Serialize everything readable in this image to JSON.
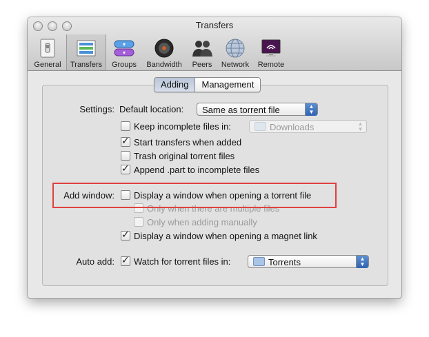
{
  "window": {
    "title": "Transfers"
  },
  "toolbar": {
    "items": [
      {
        "label": "General",
        "icon": "general-switch-icon",
        "selected": false
      },
      {
        "label": "Transfers",
        "icon": "transfers-list-icon",
        "selected": true
      },
      {
        "label": "Groups",
        "icon": "groups-pills-icon",
        "selected": false
      },
      {
        "label": "Bandwidth",
        "icon": "bandwidth-speaker-icon",
        "selected": false
      },
      {
        "label": "Peers",
        "icon": "peers-people-icon",
        "selected": false
      },
      {
        "label": "Network",
        "icon": "network-globe-icon",
        "selected": false
      },
      {
        "label": "Remote",
        "icon": "remote-monitor-icon",
        "selected": false
      }
    ]
  },
  "tabs": {
    "adding": "Adding",
    "management": "Management",
    "selected": "Adding"
  },
  "settings": {
    "label": "Settings:",
    "default_location_label": "Default location:",
    "default_location_value": "Same as torrent file",
    "keep_incomplete_label": "Keep incomplete files in:",
    "keep_incomplete_checked": false,
    "incomplete_folder": "Downloads",
    "start_transfers_label": "Start transfers when added",
    "start_transfers_checked": true,
    "trash_original_label": "Trash original torrent files",
    "trash_original_checked": false,
    "append_part_label": "Append .part to incomplete files",
    "append_part_checked": true
  },
  "add_window": {
    "label": "Add window:",
    "display_window_label": "Display a window when opening a torrent file",
    "display_window_checked": false,
    "only_multiple_label": "Only when there are multiple files",
    "only_manual_label": "Only when adding manually",
    "magnet_label": "Display a window when opening a magnet link",
    "magnet_checked": true
  },
  "auto_add": {
    "label": "Auto add:",
    "watch_label": "Watch for torrent files in:",
    "watch_checked": true,
    "watch_folder": "Torrents"
  },
  "colors": {
    "highlight": "#e04040",
    "accent": "#3a6fc1"
  }
}
